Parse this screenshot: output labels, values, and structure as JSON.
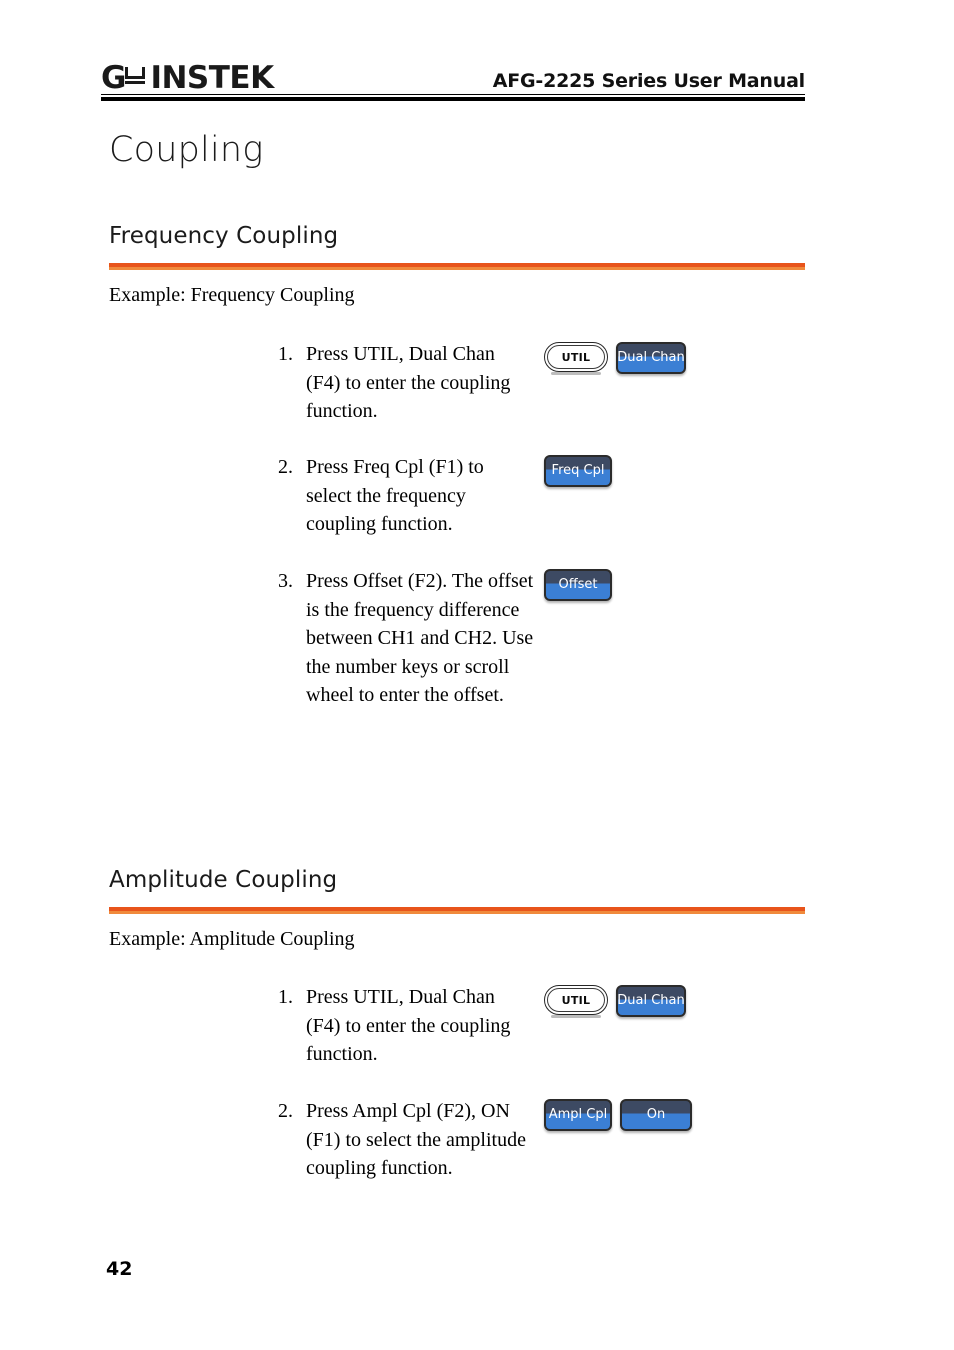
{
  "header": {
    "logo_g": "G",
    "logo_w_icon": "gw-w-logomark",
    "logo_instek": "INSTEK",
    "manual_title": "AFG-2225 Series User Manual"
  },
  "chapter": {
    "title": "Coupling"
  },
  "sections": [
    {
      "heading": "Frequency Coupling",
      "example": "Example: Frequency Coupling",
      "steps": [
        {
          "number": "1.",
          "text": "Press UTIL, Dual Chan (F4) to enter the coupling function.",
          "keys": [
            {
              "type": "hardware",
              "label": "UTIL",
              "name": "util-key"
            },
            {
              "type": "soft",
              "label": "Dual Chan",
              "name": "dual-chan-softkey",
              "width": "w-dualchan"
            }
          ]
        },
        {
          "number": "2.",
          "text": "Press Freq Cpl (F1) to select the frequency coupling function.",
          "keys": [
            {
              "type": "soft",
              "label": "Freq Cpl",
              "name": "freq-cpl-softkey",
              "width": "w-freqcpl"
            }
          ]
        },
        {
          "number": "3.",
          "text": "Press Offset (F2). The offset is the frequency difference between CH1 and CH2. Use the number keys or scroll wheel to enter the offset.",
          "keys": [
            {
              "type": "soft",
              "label": "Offset",
              "name": "offset-softkey",
              "width": "w-offset"
            }
          ]
        }
      ]
    },
    {
      "heading": "Amplitude Coupling",
      "example": "Example: Amplitude Coupling",
      "steps": [
        {
          "number": "1.",
          "text": "Press UTIL, Dual Chan (F4) to enter the coupling function.",
          "keys": [
            {
              "type": "hardware",
              "label": "UTIL",
              "name": "util-key"
            },
            {
              "type": "soft",
              "label": "Dual Chan",
              "name": "dual-chan-softkey",
              "width": "w-dualchan"
            }
          ]
        },
        {
          "number": "2.",
          "text": "Press Ampl Cpl (F2), ON (F1) to select the amplitude coupling function.",
          "keys": [
            {
              "type": "soft",
              "label": "Ampl Cpl",
              "name": "ampl-cpl-softkey",
              "width": "w-amplcpl"
            },
            {
              "type": "soft",
              "label": "On",
              "name": "on-softkey",
              "width": "w-on"
            }
          ]
        }
      ]
    }
  ],
  "footer": {
    "page_number": "42"
  },
  "colors": {
    "rule_dark_orange": "#e8541b",
    "rule_light_orange": "#f08a3c",
    "softkey_top": "#3d4a63",
    "softkey_bottom": "#3b7fd4",
    "softkey_border": "#2b2b2b",
    "text": "#000000"
  }
}
